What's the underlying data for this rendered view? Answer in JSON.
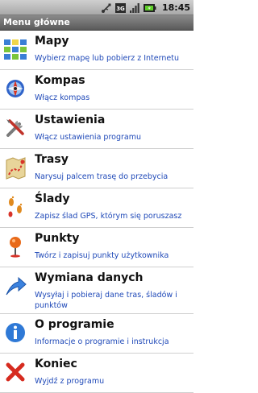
{
  "status_bar": {
    "time": "18:45",
    "icons": [
      "usb-icon",
      "3g-icon",
      "signal-icon",
      "battery-icon"
    ]
  },
  "title_bar": {
    "title": "Menu główne"
  },
  "menu": [
    {
      "title": "Mapy",
      "subtitle": "Wybierz mapę lub pobierz z Internetu",
      "icon": "map-grid-icon"
    },
    {
      "title": "Kompas",
      "subtitle": "Włącz kompas",
      "icon": "compass-icon"
    },
    {
      "title": "Ustawienia",
      "subtitle": "Włącz ustawienia programu",
      "icon": "tools-icon"
    },
    {
      "title": "Trasy",
      "subtitle": "Narysuj palcem trasę do przebycia",
      "icon": "route-icon"
    },
    {
      "title": "Ślady",
      "subtitle": "Zapisz ślad GPS, którym się poruszasz",
      "icon": "footprints-icon"
    },
    {
      "title": "Punkty",
      "subtitle": "Twórz i zapisuj punkty użytkownika",
      "icon": "pin-icon"
    },
    {
      "title": "Wymiana danych",
      "subtitle": "Wysyłaj i pobieraj dane tras, śladów i punktów",
      "icon": "upload-arrow-icon"
    },
    {
      "title": "O programie",
      "subtitle": "Informacje o programie i instrukcja",
      "icon": "info-icon"
    },
    {
      "title": "Koniec",
      "subtitle": "Wyjdź z programu",
      "icon": "exit-x-icon"
    }
  ],
  "colors": {
    "subtitle_text": "#1f49b8",
    "title_text": "#111111",
    "titlebar_bg": "#6e6e6e"
  }
}
